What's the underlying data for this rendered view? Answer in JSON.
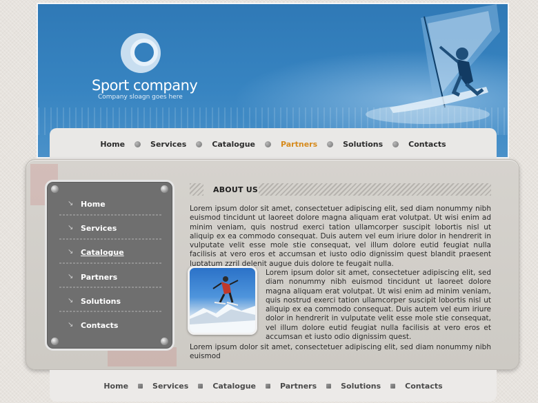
{
  "brand": {
    "title": "Sport company",
    "slogan": "Company sloagn goes here"
  },
  "nav": {
    "items": [
      {
        "label": "Home"
      },
      {
        "label": "Services"
      },
      {
        "label": "Catalogue"
      },
      {
        "label": "Partners",
        "active": true
      },
      {
        "label": "Solutions"
      },
      {
        "label": "Contacts"
      }
    ],
    "active_color": "#d68a1c"
  },
  "sidebar": {
    "items": [
      {
        "label": "Home"
      },
      {
        "label": "Services"
      },
      {
        "label": "Catalogue",
        "active": true
      },
      {
        "label": "Partners"
      },
      {
        "label": "Solutions"
      },
      {
        "label": "Contacts"
      }
    ]
  },
  "about": {
    "title": "ABOUT US",
    "para1": "Lorem ipsum dolor sit amet, consectetuer adipiscing elit, sed diam nonummy nibh euismod tincidunt ut laoreet dolore magna aliquam erat volutpat. Ut wisi enim ad minim veniam, quis nostrud exerci tation ullamcorper suscipit lobortis nisl ut aliquip ex ea commodo consequat. Duis autem vel eum iriure dolor in hendrerit in vulputate velit esse mole stie consequat, vel illum dolore eutid feugiat nulla facilisis at vero eros et accumsan et iusto odio dignissim quest blandit praesent luptatum zzril delenit augue duis dolore te feugait nulla.",
    "para2": "Lorem ipsum dolor sit amet, consectetuer adipiscing elit, sed diam nonummy nibh euismod tincidunt ut laoreet dolore magna aliquam erat volutpat. Ut wisi enim ad minim veniam, quis nostrud exerci tation ullamcorper suscipit lobortis nisl ut aliquip ex ea commodo consequat. Duis autem vel eum iriure dolor in hendrerit in vulputate velit esse mole stie consequat, vel illum dolore eutid feugiat nulla facilisis at vero eros et accumsan et iusto odio dignissim quest.",
    "para3": "Lorem ipsum dolor sit amet, consectetuer adipiscing elit, sed diam nonummy nibh euismod"
  },
  "footer": {
    "items": [
      {
        "label": "Home"
      },
      {
        "label": "Services"
      },
      {
        "label": "Catalogue"
      },
      {
        "label": "Partners"
      },
      {
        "label": "Solutions"
      },
      {
        "label": "Contacts"
      }
    ]
  },
  "icons": {
    "logo": "logo-ring-icon",
    "nav_separator": "dot-icon",
    "sidebar_arrow": "arrow-down-right-icon",
    "rivet": "rivet-icon"
  }
}
